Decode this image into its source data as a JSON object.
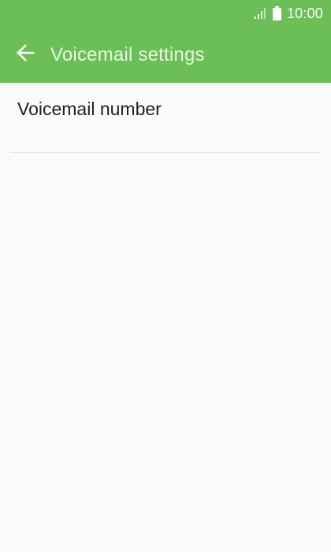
{
  "status_bar": {
    "time": "10:00",
    "icons": [
      "signal-icon",
      "battery-icon"
    ]
  },
  "app_bar": {
    "title": "Voicemail settings",
    "back_icon": "back-arrow-icon",
    "background_color": "#6cbf57"
  },
  "settings": {
    "items": [
      {
        "label": "Voicemail number"
      }
    ]
  }
}
